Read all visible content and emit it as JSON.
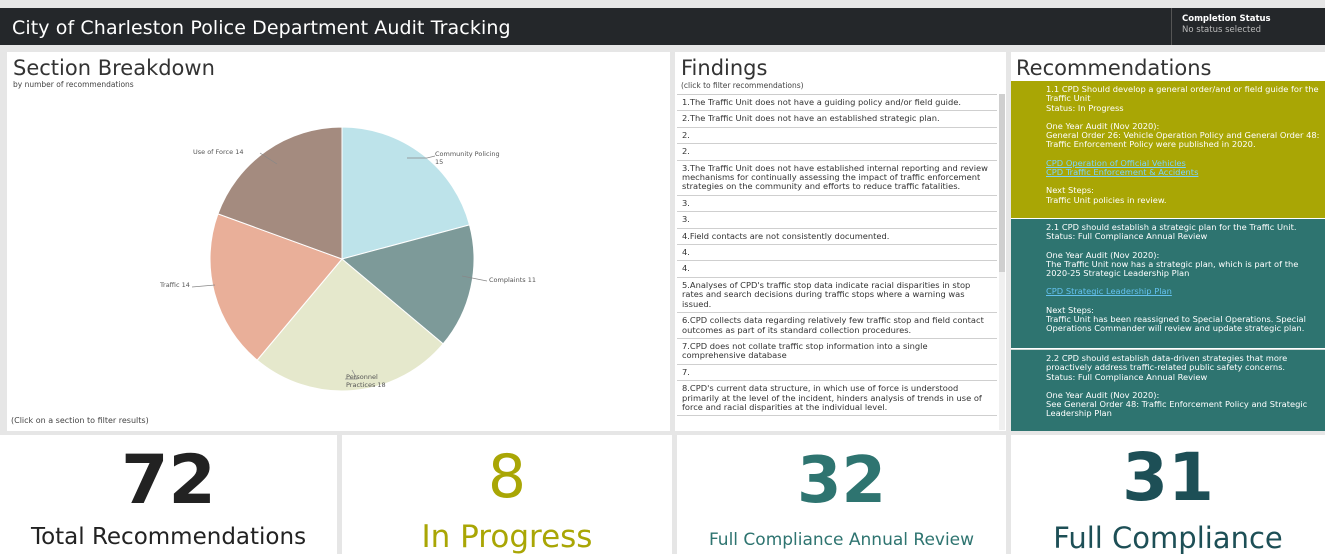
{
  "app": {
    "title": "City of Charleston Police Department Audit Tracking"
  },
  "completion_status": {
    "title": "Completion Status",
    "value": "No status selected"
  },
  "section_breakdown": {
    "title": "Section Breakdown",
    "subtitle": "by number of recommendations",
    "footnote": "(Click on a section to filter results)",
    "slices": [
      {
        "label": "Community Policing 15",
        "value": 15,
        "color": "#bde3ea"
      },
      {
        "label": "Complaints 11",
        "value": 11,
        "color": "#7d9a99"
      },
      {
        "label": "Personnel Practices 18",
        "value": 18,
        "color": "#e5e8cc"
      },
      {
        "label": "Traffic 14",
        "value": 14,
        "color": "#e9af99"
      },
      {
        "label": "Use of Force 14",
        "value": 14,
        "color": "#a48b7f"
      }
    ]
  },
  "chart_data": {
    "type": "pie",
    "title": "Section Breakdown",
    "subtitle": "by number of recommendations",
    "categories": [
      "Community Policing",
      "Complaints",
      "Personnel Practices",
      "Traffic",
      "Use of Force"
    ],
    "values": [
      15,
      11,
      18,
      14,
      14
    ]
  },
  "findings": {
    "title": "Findings",
    "subtitle": "(click to filter recommendations)",
    "items": [
      "1.The Traffic Unit does not have a guiding policy and/or field guide.",
      "2.The Traffic Unit does not have an established strategic plan.",
      "2.",
      "2.",
      "3.The Traffic Unit does not have established internal reporting and review mechanisms for continually assessing the impact of traffic enforcement strategies on the community and efforts to reduce traffic fatalities.",
      "3.",
      "3.",
      "4.Field contacts are not consistently documented.",
      "4.",
      "4.",
      "5.Analyses of CPD's traffic stop data indicate racial disparities in stop rates and search decisions during traffic stops where a warning was issued.",
      "6.CPD collects data regarding relatively few traffic stop and field contact outcomes as part of its standard collection procedures.",
      "7.CPD does not collate traffic stop information into a single comprehensive database",
      "7.",
      "8.CPD's current data structure, in which use of force is understood primarily at the level of the incident, hinders analysis of trends in use of force and racial disparities at the individual level."
    ]
  },
  "recommendations": {
    "title": "Recommendations",
    "items": [
      {
        "color": "#a9a605",
        "text": "1.1 CPD Should develop a general order/and or field guide for the Traffic Unit",
        "status": "Status: In Progress",
        "audit_heading": "One Year Audit (Nov 2020):",
        "audit_text": "General Order 26: Vehicle Operation Policy and General Order 48: Traffic Enforcement Policy were published in 2020.",
        "links": [
          "CPD Operation of Official Vehicles",
          "CPD Traffic Enforcement & Accidents"
        ],
        "next_heading": "Next Steps:",
        "next_text": "Traffic Unit policies in review."
      },
      {
        "color": "#2e7470",
        "text": "2.1 CPD should establish a strategic plan for the Traffic Unit.",
        "status": "Status: Full Compliance Annual Review",
        "audit_heading": "One Year Audit (Nov 2020):",
        "audit_text": "The Traffic Unit now has a strategic plan, which is part of the 2020-25 Strategic Leadership Plan",
        "links": [
          "CPD Strategic Leadership Plan"
        ],
        "next_heading": "Next Steps:",
        "next_text": "Traffic Unit has been reassigned to Special Operations. Special Operations Commander will review and update strategic plan."
      },
      {
        "color": "#2e7470",
        "text": "2.2 CPD should establish data-driven strategies that more proactively address traffic-related public safety concerns.",
        "status": "Status: Full Compliance Annual Review",
        "audit_heading": "One Year Audit (Nov 2020):",
        "audit_text": "See General Order 48: Traffic Enforcement Policy and Strategic Leadership Plan"
      }
    ]
  },
  "kpis": [
    {
      "number": "72",
      "label": "Total Recommendations",
      "color": "#222222"
    },
    {
      "number": "8",
      "label": "In Progress",
      "color": "#a9a605"
    },
    {
      "number": "32",
      "label": "Full Compliance Annual Review",
      "color": "#2e7470"
    },
    {
      "number": "31",
      "label": "Full Compliance",
      "color": "#1d4f56"
    }
  ]
}
